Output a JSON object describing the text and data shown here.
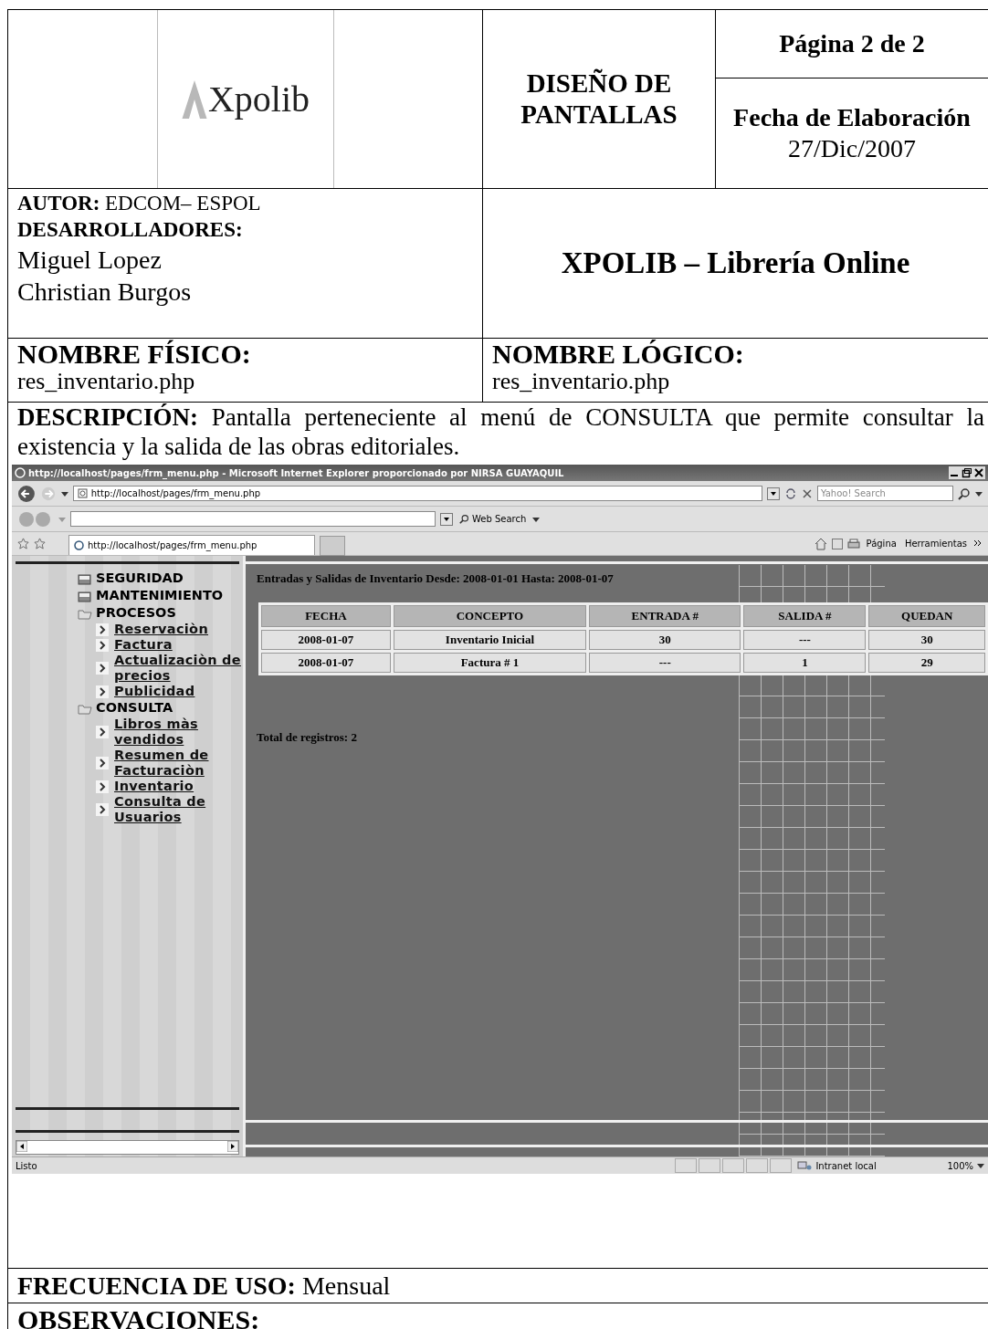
{
  "header": {
    "logo": "Xpolib",
    "title": "DISEÑO DE PANTALLAS",
    "page": "Página 2 de 2",
    "date_label": "Fecha de Elaboración",
    "date": "27/Dic/2007"
  },
  "author": {
    "text": "**AUTOR:** EDCOM– ESPOL",
    "developers_label": "DESARROLLADORES:",
    "developers": [
      "Miguel Lopez",
      "Christian Burgos"
    ]
  },
  "system_name": "XPOLIB – Librería Online",
  "physical_name": {
    "label": "NOMBRE FÍSICO:",
    "value": "res_inventario.php"
  },
  "logical_name": {
    "label": "NOMBRE LÓGICO:",
    "value": "res_inventario.php"
  },
  "description": "**DESCRIPCIÓN:** Pantalla perteneciente al menú de CONSULTA que permite consultar la existencia y la salida de las obras editoriales.",
  "browser": {
    "title": "http://localhost/pages/frm_menu.php - Microsoft Internet Explorer proporcionado por NIRSA GUAYAQUIL",
    "address": "http://localhost/pages/frm_menu.php",
    "search_placeholder": "Yahoo! Search",
    "web_search": "Web Search",
    "tab": "http://localhost/pages/frm_menu.php",
    "page_menu": "Página",
    "tools_menu": "Herramientas",
    "menu": [
      {
        "label": "SEGURIDAD",
        "expanded": false
      },
      {
        "label": "MANTENIMIENTO",
        "expanded": false
      },
      {
        "label": "PROCESOS",
        "expanded": true,
        "children": [
          {
            "label": "Reservaciòn"
          },
          {
            "label": "Factura"
          },
          {
            "label": "Actualizaciòn de precios"
          },
          {
            "label": "Publicidad"
          }
        ]
      },
      {
        "label": "CONSULTA",
        "expanded": true,
        "children": [
          {
            "label": "Libros màs vendidos"
          },
          {
            "label": "Resumen de Facturaciòn"
          },
          {
            "label": "Inventario"
          },
          {
            "label": "Consulta de Usuarios"
          }
        ]
      }
    ],
    "heading": "Entradas y Salidas de Inventario Desde: 2008-01-01 Hasta: 2008-01-07",
    "table": {
      "columns": [
        "FECHA",
        "CONCEPTO",
        "ENTRADA #",
        "SALIDA #",
        "QUEDAN"
      ],
      "rows": [
        [
          "2008-01-07",
          "Inventario Inicial",
          "30",
          "---",
          "30"
        ],
        [
          "2008-01-07",
          "Factura # 1",
          "---",
          "1",
          "29"
        ]
      ]
    },
    "total": "Total de registros: 2",
    "status": "Listo",
    "zone": "Intranet local",
    "zoom": "100%"
  },
  "frequency": "**FRECUENCIA DE USO:** Mensual",
  "observations": "OBSERVACIONES:"
}
